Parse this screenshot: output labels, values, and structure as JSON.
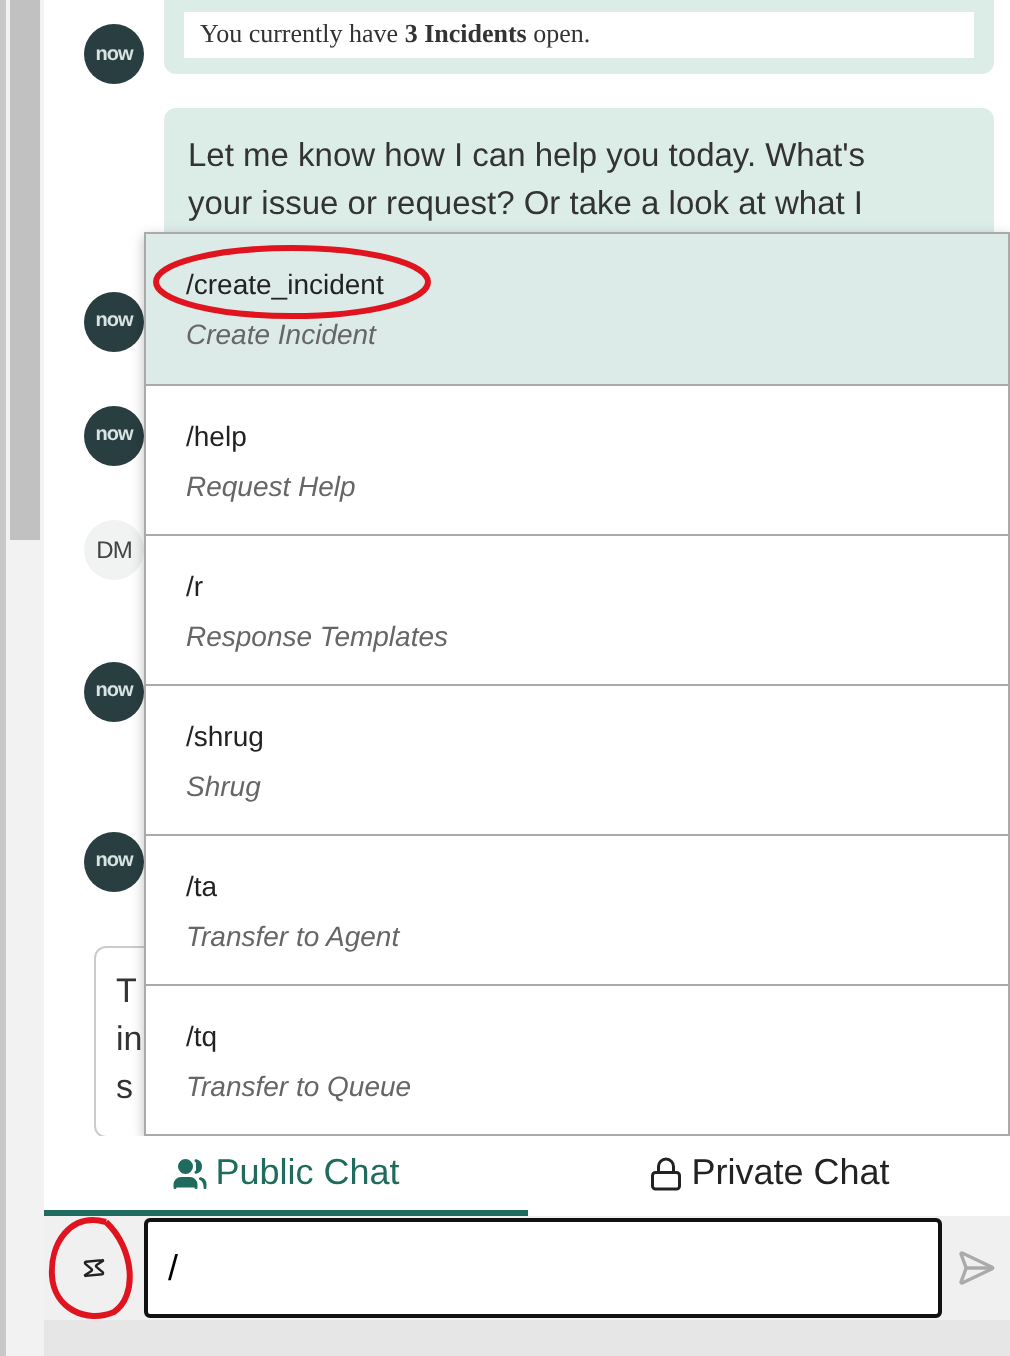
{
  "messages": [
    {
      "kind": "bot",
      "avatar": "now",
      "card": "You currently have **3 Incidents** open."
    },
    {
      "kind": "bot_text",
      "text": "Let me know how I can help you today. What's your issue or request? Or take a look at what I"
    },
    {
      "kind": "avatar",
      "avatar": "now"
    },
    {
      "kind": "avatar",
      "avatar": "now"
    },
    {
      "kind": "user_avatar",
      "avatar": "DM"
    },
    {
      "kind": "avatar",
      "avatar": "now"
    },
    {
      "kind": "avatar",
      "avatar": "now"
    },
    {
      "kind": "partial",
      "lines": [
        "T",
        "in",
        "s"
      ]
    }
  ],
  "commands": [
    {
      "command": "/create_incident",
      "description": "Create Incident",
      "selected": true,
      "circled": true
    },
    {
      "command": "/help",
      "description": "Request Help",
      "selected": false,
      "circled": false
    },
    {
      "command": "/r",
      "description": "Response Templates",
      "selected": false,
      "circled": false
    },
    {
      "command": "/shrug",
      "description": "Shrug",
      "selected": false,
      "circled": false
    },
    {
      "command": "/ta",
      "description": "Transfer to Agent",
      "selected": false,
      "circled": false
    },
    {
      "command": "/tq",
      "description": "Transfer to Queue",
      "selected": false,
      "circled": false
    }
  ],
  "tabs": [
    {
      "label": "Public Chat",
      "selected": true
    },
    {
      "label": "Private Chat",
      "selected": false
    }
  ],
  "composer": {
    "value": "/",
    "shortcut_circled": true
  }
}
